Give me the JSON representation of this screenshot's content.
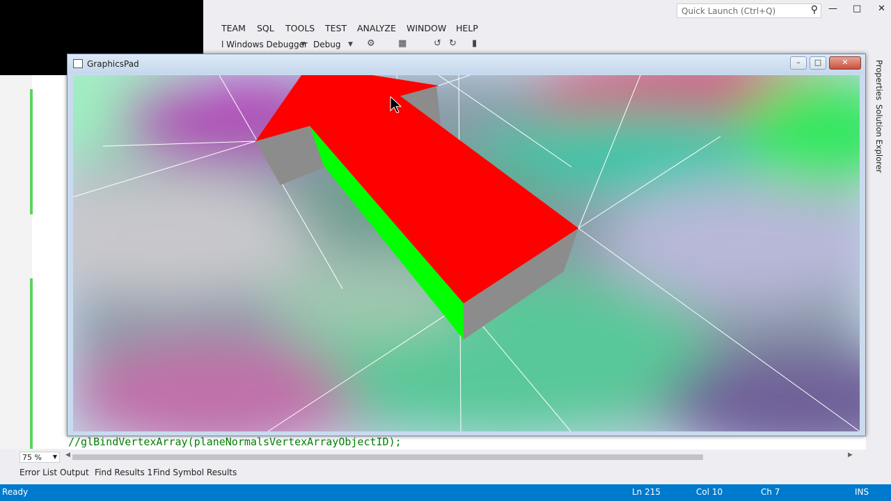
{
  "menu": {
    "items": [
      "TEAM",
      "SQL",
      "TOOLS",
      "TEST",
      "ANALYZE",
      "WINDOW",
      "HELP"
    ]
  },
  "quick_launch": {
    "placeholder": "Quick Launch (Ctrl+Q)",
    "icon": "search-icon"
  },
  "toolbar": {
    "debugger_label": "l Windows Debugger",
    "config_label": "Debug"
  },
  "graphics_window": {
    "title": "GraphicsPad"
  },
  "right_sidebar": {
    "tabs": [
      "Properties",
      "Solution Explorer"
    ]
  },
  "editor": {
    "code_line": "//glBindVertexArray(planeNormalsVertexArrayObjectID);"
  },
  "zoom": {
    "value": "75 %"
  },
  "bottom_tabs": [
    "Error List",
    "Output",
    "Find Results 1",
    "Find Symbol Results"
  ],
  "status_bar": {
    "state": "Ready",
    "line": "Ln 215",
    "col": "Col 10",
    "ch": "Ch 7",
    "mode": "INS"
  },
  "colors": {
    "status_bar": "#007acc",
    "box_top": "#ff0000",
    "box_side": "#00ff00",
    "box_end": "#8c8c8c",
    "code_comment": "#008000"
  }
}
